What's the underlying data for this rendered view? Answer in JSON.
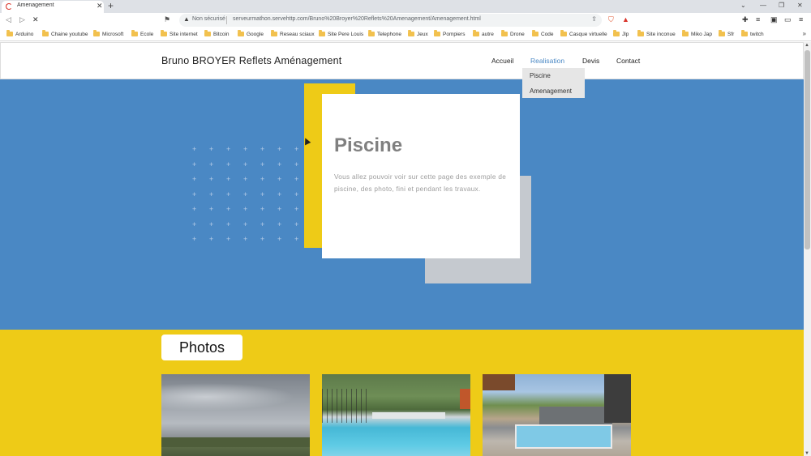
{
  "browser": {
    "tab_title": "Amenagement",
    "security_label": "Non sécurisé",
    "url": "serveurmathon.servehttp.com/Bruno%20Broyer%20Reflets%20Amenagement/Amenagement.html"
  },
  "bookmarks": [
    "Arduino",
    "Chaine youtube",
    "Microsoft",
    "Ecole",
    "Site internet",
    "Bitcoin",
    "Google",
    "Reseau sciaux",
    "Site Pere Louis",
    "Telephone",
    "Jeux",
    "Pompiers",
    "autre",
    "Drone",
    "Code",
    "Casque virtuelle",
    "Jlp",
    "Site inconue",
    "Miko Jap",
    "Sfr",
    "twitch"
  ],
  "site": {
    "brand": "Bruno BROYER Reflets Aménagement",
    "nav": [
      "Accueil",
      "Realisation",
      "Devis",
      "Contact"
    ],
    "active_nav": "Realisation",
    "dropdown": [
      "Piscine",
      "Amenagement"
    ]
  },
  "hero": {
    "title": "Piscine",
    "text": "Vous allez pouvoir voir sur cette page des exemple de piscine, des photo, fini et pendant les travaux."
  },
  "photos": {
    "button_label": "Photos"
  },
  "colors": {
    "hero_blue": "#4a88c4",
    "accent_yellow": "#eecb17",
    "card_shadow_gray": "#c5c9cf",
    "active_nav": "#4a88c4"
  }
}
